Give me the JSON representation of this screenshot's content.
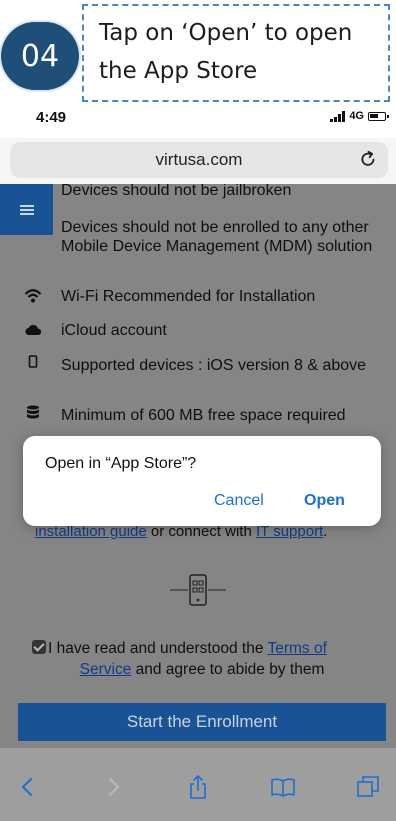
{
  "step": {
    "number": "04",
    "instruction": "Tap on ‘Open’ to open the App Store"
  },
  "status_bar": {
    "time": "4:49",
    "network": "4G"
  },
  "browser": {
    "url": "virtusa.com"
  },
  "page": {
    "requirements": [
      "Devices should not be jailbroken",
      "Devices should not be enrolled to any other Mobile Device Management (MDM) solution"
    ],
    "features": [
      {
        "icon": "wifi-icon",
        "text": "Wi-Fi Recommended for Installation"
      },
      {
        "icon": "cloud-icon",
        "text": "iCloud account"
      },
      {
        "icon": "phone-icon",
        "text": "Supported devices : iOS version 8 & above"
      },
      {
        "icon": "storage-icon",
        "text": "Minimum of 600 MB free space required"
      }
    ],
    "guide_line": {
      "guide_link": "installation guide",
      "middle": " or connect with ",
      "support_link": "IT support",
      "end": "."
    },
    "terms": {
      "checked": true,
      "prefix": "I have read and understood the ",
      "link_part1": "Terms of",
      "link_part2": "Service",
      "suffix": " and agree to abide by them"
    },
    "enroll_button": "Start the Enrollment"
  },
  "dialog": {
    "title": "Open in “App Store”?",
    "cancel_label": "Cancel",
    "open_label": "Open"
  },
  "colors": {
    "accent_blue": "#1a5296",
    "dialog_link": "#1a6fd6",
    "step_circle": "#1f4e79",
    "overlay_gray": "#858585"
  }
}
